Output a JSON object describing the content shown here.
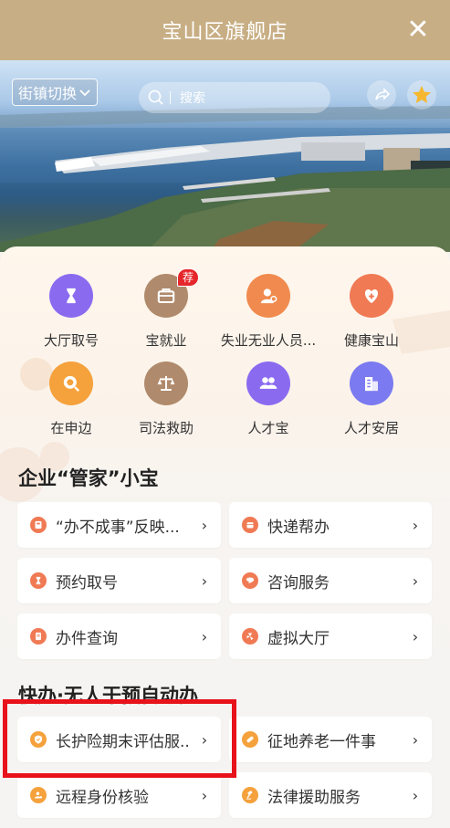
{
  "header": {
    "title": "宝山区旗舰店",
    "close_label": "✕"
  },
  "banner": {
    "district_switch": "街镇切换",
    "search_placeholder": "搜索"
  },
  "grid": [
    {
      "label": "大厅取号",
      "icon": "hourglass-icon",
      "color": "#8a6bf0"
    },
    {
      "label": "宝就业",
      "icon": "briefcase-icon",
      "color": "#b08a6c",
      "badge": "荐"
    },
    {
      "label": "失业无业人员...",
      "icon": "person-search-icon",
      "color": "#f08a4e"
    },
    {
      "label": "健康宝山",
      "icon": "heart-plus-icon",
      "color": "#f07a54"
    },
    {
      "label": "在申边",
      "icon": "magnifier-icon",
      "color": "#f5a13c"
    },
    {
      "label": "司法救助",
      "icon": "scales-icon",
      "color": "#b08a6c"
    },
    {
      "label": "人才宝",
      "icon": "people-icon",
      "color": "#8a6bf0"
    },
    {
      "label": "人才安居",
      "icon": "buildings-icon",
      "color": "#7b7af0"
    }
  ],
  "section1": {
    "title": "企业“管家”小宝",
    "cards": [
      {
        "label": "“办不成事”反映...",
        "icon": "flag-icon",
        "color": "#f07a54"
      },
      {
        "label": "快递帮办",
        "icon": "package-icon",
        "color": "#f07a54"
      },
      {
        "label": "预约取号",
        "icon": "hourglass-icon",
        "color": "#f07a54"
      },
      {
        "label": "咨询服务",
        "icon": "chat-icon",
        "color": "#f07a54"
      },
      {
        "label": "办件查询",
        "icon": "document-icon",
        "color": "#f07a54"
      },
      {
        "label": "虚拟大厅",
        "icon": "fan-icon",
        "color": "#f07a54"
      }
    ]
  },
  "section2": {
    "title": "快办·无人干预自动办",
    "cards": [
      {
        "label": "长护险期末评估服..",
        "icon": "shield-icon",
        "color": "#f5a13c"
      },
      {
        "label": "征地养老一件事",
        "icon": "pill-icon",
        "color": "#f5a13c"
      },
      {
        "label": "远程身份核验",
        "icon": "person-badge-icon",
        "color": "#f5a13c"
      },
      {
        "label": "法律援助服务",
        "icon": "gavel-icon",
        "color": "#f5a13c"
      }
    ]
  },
  "arrow_glyph": "›"
}
